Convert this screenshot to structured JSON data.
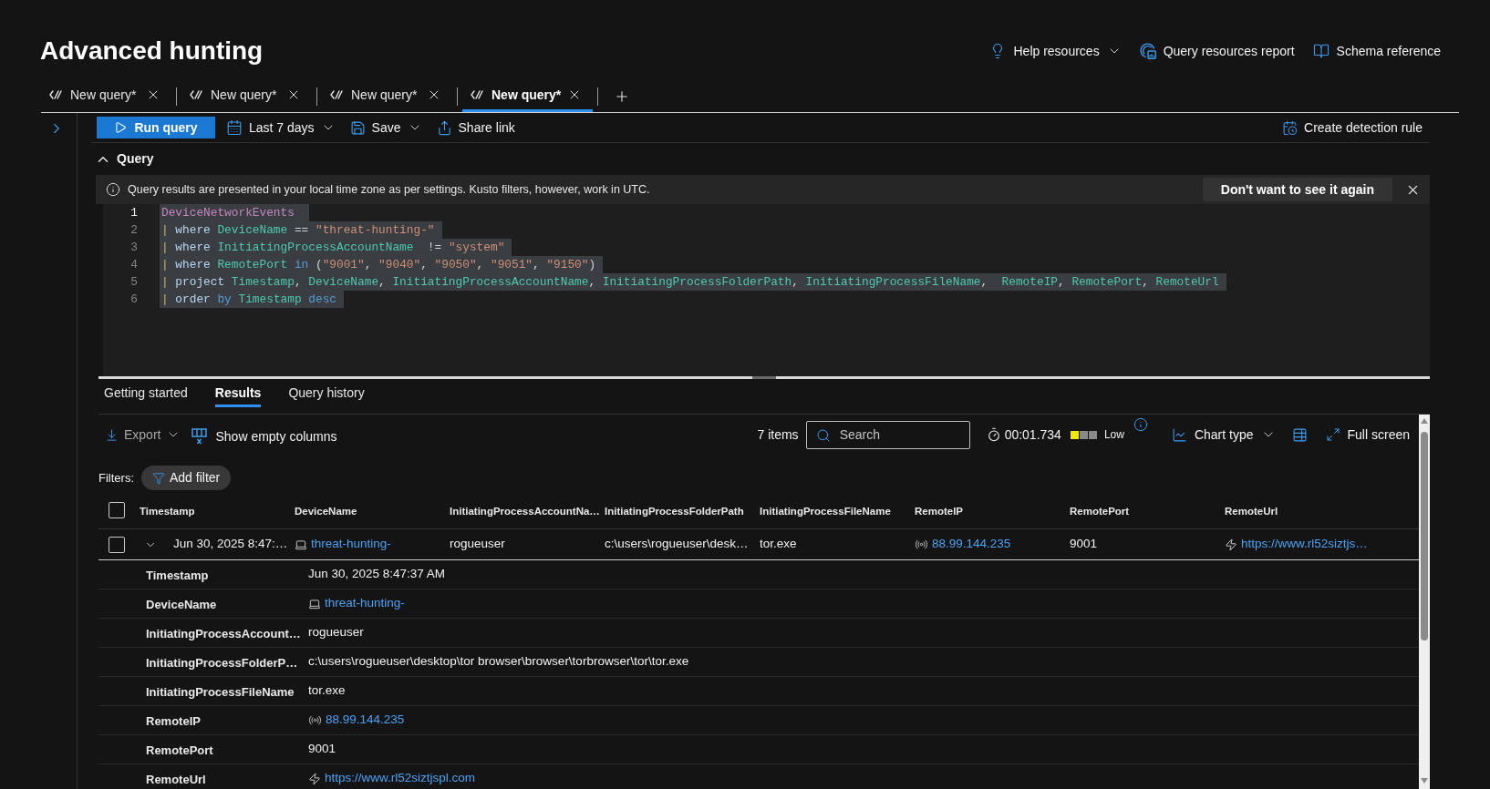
{
  "header": {
    "title": "Advanced hunting",
    "links": [
      {
        "label": "Help resources",
        "has_menu": true
      },
      {
        "label": "Query resources report",
        "has_menu": false
      },
      {
        "label": "Schema reference",
        "has_menu": false
      }
    ]
  },
  "query_tabs": [
    {
      "label": "New query*",
      "selected": false
    },
    {
      "label": "New query*",
      "selected": false
    },
    {
      "label": "New query*",
      "selected": false
    },
    {
      "label": "New query*",
      "selected": true
    }
  ],
  "toolbar": {
    "run_button": "Run query",
    "actions": [
      {
        "label": "Last 7 days",
        "has_menu": true
      },
      {
        "label": "Save",
        "has_menu": true
      },
      {
        "label": "Share link",
        "has_menu": false
      }
    ],
    "create_rule": "Create detection rule"
  },
  "query_section": {
    "title": "Query",
    "expanded": true,
    "notice": "Query results are presented in your local time zone as per settings. Kusto filters, however, work in UTC.",
    "dismiss_button": "Don't want to see it again",
    "code_selected": true,
    "lines": [
      {
        "number": "1",
        "current": true,
        "tokens": [
          {
            "kind": "table",
            "text": "DeviceNetworkEvents "
          }
        ]
      },
      {
        "number": "2",
        "current": false,
        "tokens": [
          {
            "kind": "pipe",
            "text": "| "
          },
          {
            "kind": "keyword",
            "text": "where "
          },
          {
            "kind": "field",
            "text": "DeviceName "
          },
          {
            "kind": "plain",
            "text": "== "
          },
          {
            "kind": "string",
            "text": "\"threat-hunting-\""
          }
        ]
      },
      {
        "number": "3",
        "current": false,
        "tokens": [
          {
            "kind": "pipe",
            "text": "| "
          },
          {
            "kind": "keyword",
            "text": "where "
          },
          {
            "kind": "field",
            "text": "InitiatingProcessAccountName  "
          },
          {
            "kind": "plain",
            "text": "!= "
          },
          {
            "kind": "string",
            "text": "\"system\""
          }
        ]
      },
      {
        "number": "4",
        "current": false,
        "tokens": [
          {
            "kind": "pipe",
            "text": "| "
          },
          {
            "kind": "keyword",
            "text": "where "
          },
          {
            "kind": "field",
            "text": "RemotePort "
          },
          {
            "kind": "operator",
            "text": "in "
          },
          {
            "kind": "plain",
            "text": "("
          },
          {
            "kind": "string",
            "text": "\"9001\""
          },
          {
            "kind": "plain",
            "text": ", "
          },
          {
            "kind": "string",
            "text": "\"9040\""
          },
          {
            "kind": "plain",
            "text": ", "
          },
          {
            "kind": "string",
            "text": "\"9050\""
          },
          {
            "kind": "plain",
            "text": ", "
          },
          {
            "kind": "string",
            "text": "\"9051\""
          },
          {
            "kind": "plain",
            "text": ", "
          },
          {
            "kind": "string",
            "text": "\"9150\""
          },
          {
            "kind": "plain",
            "text": ")"
          }
        ]
      },
      {
        "number": "5",
        "current": false,
        "tokens": [
          {
            "kind": "pipe",
            "text": "| "
          },
          {
            "kind": "keyword",
            "text": "project "
          },
          {
            "kind": "field",
            "text": "Timestamp"
          },
          {
            "kind": "plain",
            "text": ", "
          },
          {
            "kind": "field",
            "text": "DeviceName"
          },
          {
            "kind": "plain",
            "text": ", "
          },
          {
            "kind": "field",
            "text": "InitiatingProcessAccountName"
          },
          {
            "kind": "plain",
            "text": ", "
          },
          {
            "kind": "field",
            "text": "InitiatingProcessFolderPath"
          },
          {
            "kind": "plain",
            "text": ", "
          },
          {
            "kind": "field",
            "text": "InitiatingProcessFileName"
          },
          {
            "kind": "plain",
            "text": ",  "
          },
          {
            "kind": "field",
            "text": "RemoteIP"
          },
          {
            "kind": "plain",
            "text": ", "
          },
          {
            "kind": "field",
            "text": "RemotePort"
          },
          {
            "kind": "plain",
            "text": ", "
          },
          {
            "kind": "field",
            "text": "RemoteUrl"
          }
        ]
      },
      {
        "number": "6",
        "current": false,
        "tokens": [
          {
            "kind": "pipe",
            "text": "| "
          },
          {
            "kind": "keyword",
            "text": "order "
          },
          {
            "kind": "operator",
            "text": "by "
          },
          {
            "kind": "field",
            "text": "Timestamp "
          },
          {
            "kind": "operator",
            "text": "desc"
          }
        ]
      }
    ]
  },
  "results_tabs": [
    {
      "label": "Getting started",
      "selected": false
    },
    {
      "label": "Results",
      "selected": true
    },
    {
      "label": "Query history",
      "selected": false
    }
  ],
  "results_toolbar": {
    "export": {
      "label": "Export",
      "disabled": true
    },
    "show_empty_columns": "Show empty columns",
    "item_count": "7 items",
    "search": {
      "placeholder": "Search"
    },
    "duration": "00:01.734",
    "resource_usage": {
      "level": 0.33,
      "label": "Low"
    },
    "chart_type": "Chart type",
    "full_screen": "Full screen"
  },
  "filters": {
    "label": "Filters:",
    "add_button": "Add filter"
  },
  "table": {
    "select_all_checked": false,
    "columns": [
      "Timestamp",
      "DeviceName",
      "InitiatingProcessAccountNa…",
      "InitiatingProcessFolderPath",
      "InitiatingProcessFileName",
      "RemoteIP",
      "RemotePort",
      "RemoteUrl"
    ],
    "rows": [
      {
        "checked": false,
        "expanded": true,
        "cells": [
          {
            "kind": "text",
            "text": "Jun 30, 2025 8:47:…"
          },
          {
            "kind": "device",
            "text": "threat-hunting-"
          },
          {
            "kind": "text",
            "text": "rogueuser"
          },
          {
            "kind": "text",
            "text": "c:\\users\\rogueuser\\desk…"
          },
          {
            "kind": "text",
            "text": "tor.exe"
          },
          {
            "kind": "ip",
            "text": "88.99.144.235"
          },
          {
            "kind": "text",
            "text": "9001"
          },
          {
            "kind": "url",
            "text": "https://www.rl52siztjs…"
          }
        ],
        "details": [
          {
            "label": "Timestamp",
            "kind": "text",
            "value": "Jun 30, 2025 8:47:37 AM"
          },
          {
            "label": "DeviceName",
            "kind": "device",
            "value": "threat-hunting-"
          },
          {
            "label": "InitiatingProcessAccount…",
            "kind": "text",
            "value": "rogueuser"
          },
          {
            "label": "InitiatingProcessFolderP…",
            "kind": "text",
            "value": "c:\\users\\rogueuser\\desktop\\tor browser\\browser\\torbrowser\\tor\\tor.exe"
          },
          {
            "label": "InitiatingProcessFileName",
            "kind": "text",
            "value": "tor.exe"
          },
          {
            "label": "RemoteIP",
            "kind": "ip",
            "value": "88.99.144.235"
          },
          {
            "label": "RemotePort",
            "kind": "text",
            "value": "9001"
          },
          {
            "label": "RemoteUrl",
            "kind": "url",
            "value": "https://www.rl52siztjspl.com"
          }
        ]
      }
    ]
  }
}
